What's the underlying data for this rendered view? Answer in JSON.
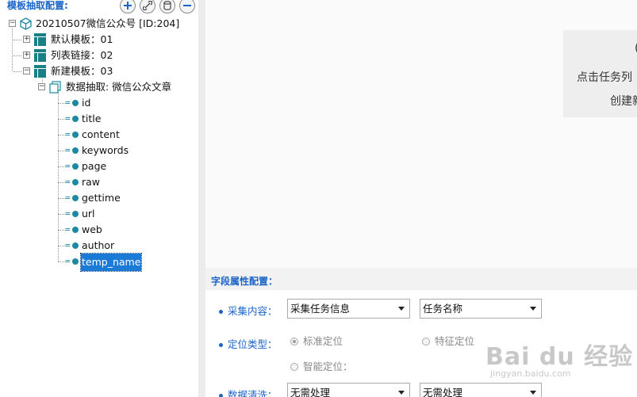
{
  "left_panel": {
    "title": "模板抽取配置:",
    "toolbar": {
      "add_icon": "plus-icon",
      "link_icon": "link-icon",
      "db_icon": "database-icon",
      "remove_icon": "minus-icon"
    },
    "tree": {
      "root": "20210507微信公众号 [ID:204]",
      "templates": [
        {
          "label": "默认模板：01",
          "expander": "+"
        },
        {
          "label": "列表链接：02",
          "expander": "+"
        },
        {
          "label": "新建模板：03",
          "expander": "−"
        }
      ],
      "extract_node": "数据抽取: 微信公众文章",
      "fields": [
        "id",
        "title",
        "content",
        "keywords",
        "page",
        "raw",
        "gettime",
        "url",
        "web",
        "author",
        "temp_name"
      ],
      "selected_field": "temp_name",
      "field_icon_prefix": "=",
      "expander_minus": "−"
    }
  },
  "right_top": {
    "hint_line1": "(",
    "hint_line2": "点击任务列",
    "hint_line3": "创建新"
  },
  "field_config": {
    "title": "字段属性配置：",
    "collect_label": "采集内容：",
    "collect_select1": "采集任务信息",
    "collect_select2": "任务名称",
    "locate_label": "定位类型：",
    "radio_standard": "标准定位",
    "radio_feature": "特征定位",
    "radio_smart": "智能定位：",
    "clean_label": "数据清洗：",
    "clean_select1": "无需处理",
    "clean_select2": "无需处理"
  },
  "watermark": {
    "main": "Bai du 经验",
    "sub": "jingyan.baidu.com"
  },
  "colors": {
    "accent": "#1a64c8",
    "field_icon": "#1b8aa0",
    "selection": "#1a7ad6",
    "template_icon": "#1b7f86"
  }
}
